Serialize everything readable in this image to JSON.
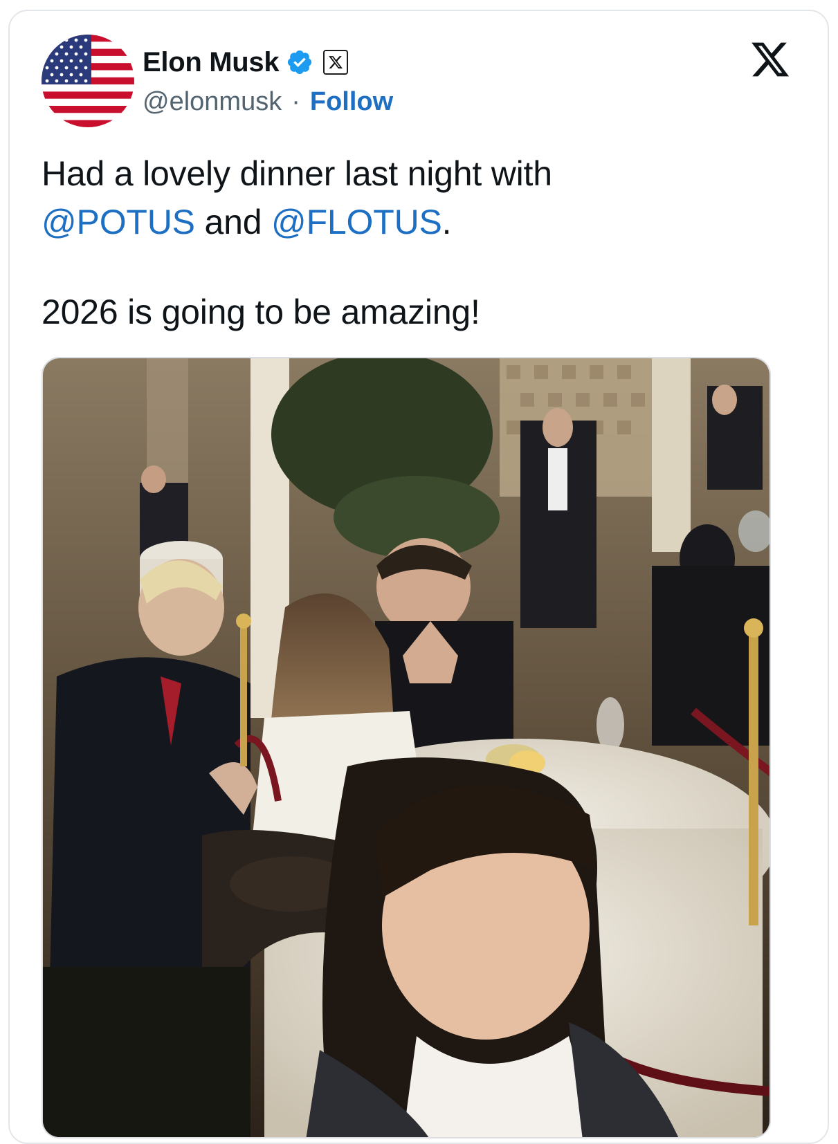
{
  "author": {
    "name": "Elon Musk",
    "handle": "@elonmusk",
    "separator": "·",
    "follow_label": "Follow",
    "avatar_icon": "us-flag-icon",
    "verified_icon": "verified-badge-icon",
    "affiliation_icon": "x-affiliate-badge-icon"
  },
  "platform_icon": "x-logo-icon",
  "tweet": {
    "line1": "Had a lovely dinner last night with",
    "mention1": "@POTUS",
    "and": " and ",
    "mention2": "@FLOTUS",
    "period": ".",
    "line2": "2026 is going to be amazing!"
  },
  "colors": {
    "link": "#1d6fc4",
    "verified": "#1d9bf0",
    "text": "#0f1419",
    "secondary": "#536471"
  }
}
